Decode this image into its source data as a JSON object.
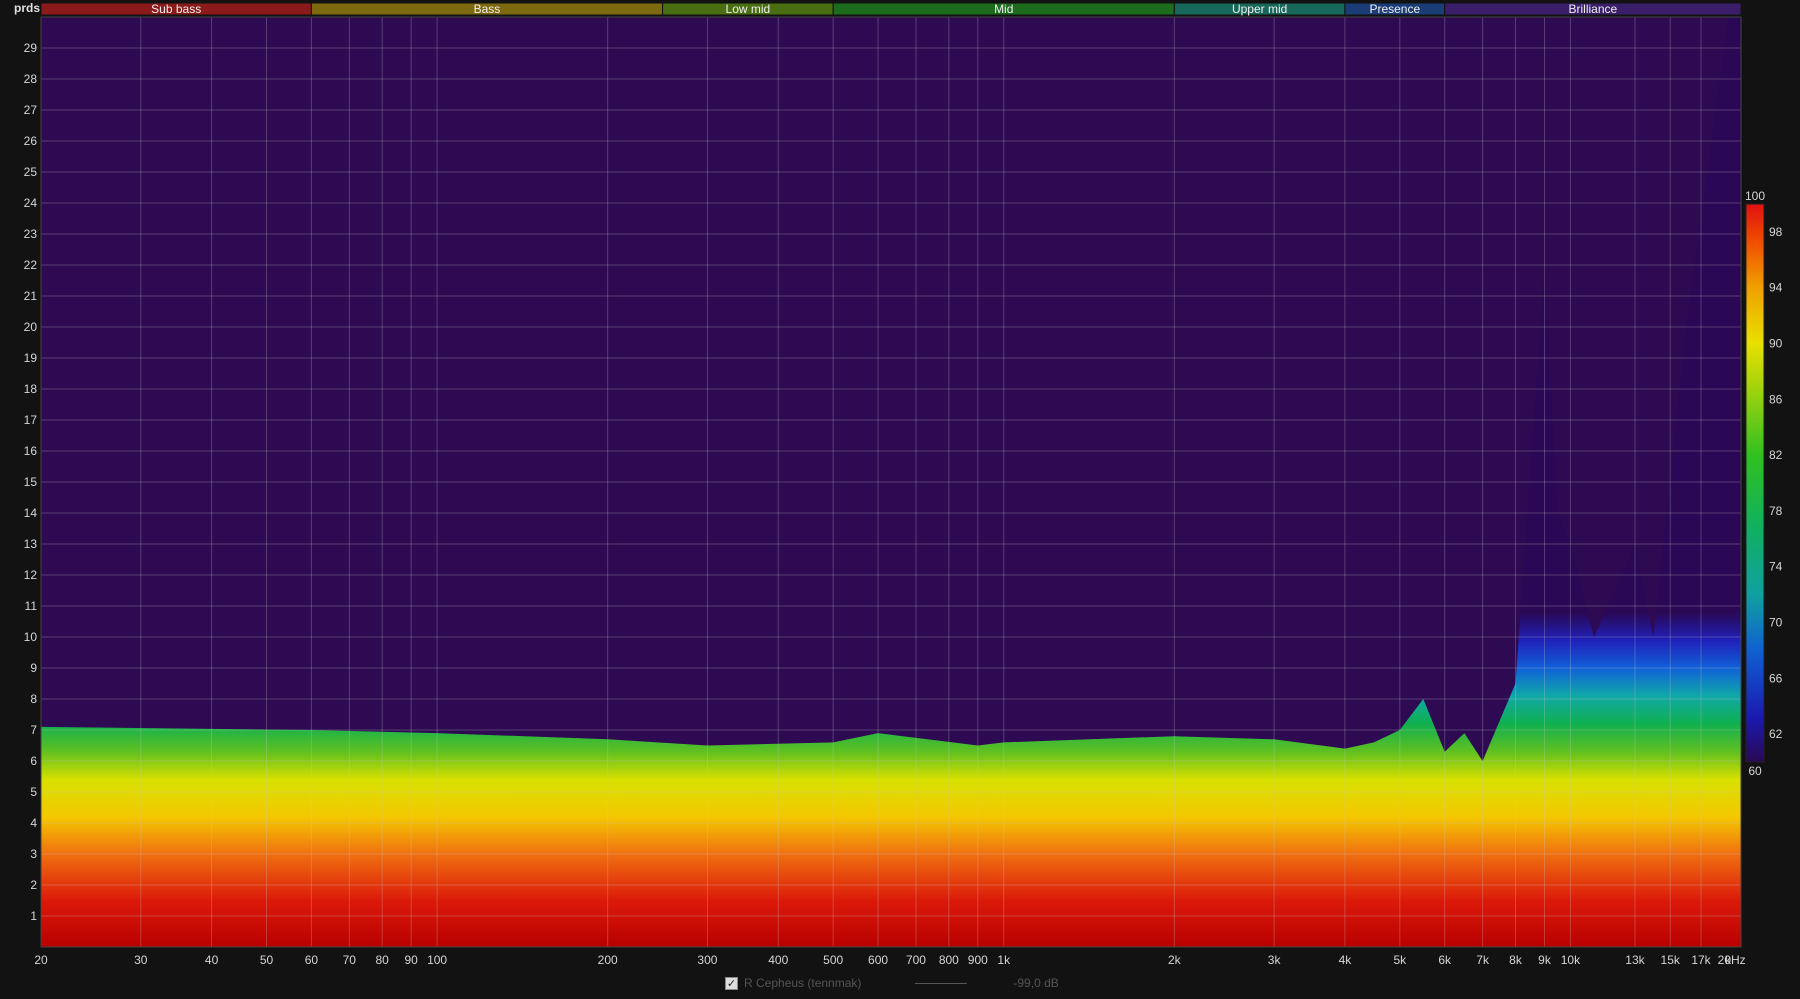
{
  "chart_data": {
    "type": "heatmap",
    "title": "",
    "y_unit_label": "prds",
    "x_unit_label": "kHz",
    "x_scale": "log",
    "x_range_hz": [
      20,
      20000
    ],
    "y_range_periods": [
      0,
      30
    ],
    "y_ticks": [
      "1",
      "2",
      "3",
      "4",
      "5",
      "6",
      "7",
      "8",
      "9",
      "10",
      "11",
      "12",
      "13",
      "14",
      "15",
      "16",
      "17",
      "18",
      "19",
      "20",
      "21",
      "22",
      "23",
      "24",
      "25",
      "26",
      "27",
      "28",
      "29"
    ],
    "x_ticks": [
      {
        "hz": 20,
        "label": "20"
      },
      {
        "hz": 30,
        "label": "30"
      },
      {
        "hz": 40,
        "label": "40"
      },
      {
        "hz": 50,
        "label": "50"
      },
      {
        "hz": 60,
        "label": "60"
      },
      {
        "hz": 70,
        "label": "70"
      },
      {
        "hz": 80,
        "label": "80"
      },
      {
        "hz": 90,
        "label": "90"
      },
      {
        "hz": 100,
        "label": "100"
      },
      {
        "hz": 200,
        "label": "200"
      },
      {
        "hz": 300,
        "label": "300"
      },
      {
        "hz": 400,
        "label": "400"
      },
      {
        "hz": 500,
        "label": "500"
      },
      {
        "hz": 600,
        "label": "600"
      },
      {
        "hz": 700,
        "label": "700"
      },
      {
        "hz": 800,
        "label": "800"
      },
      {
        "hz": 900,
        "label": "900"
      },
      {
        "hz": 1000,
        "label": "1k"
      },
      {
        "hz": 2000,
        "label": "2k"
      },
      {
        "hz": 3000,
        "label": "3k"
      },
      {
        "hz": 4000,
        "label": "4k"
      },
      {
        "hz": 5000,
        "label": "5k"
      },
      {
        "hz": 6000,
        "label": "6k"
      },
      {
        "hz": 7000,
        "label": "7k"
      },
      {
        "hz": 8000,
        "label": "8k"
      },
      {
        "hz": 9000,
        "label": "9k"
      },
      {
        "hz": 10000,
        "label": "10k"
      },
      {
        "hz": 13000,
        "label": "13k"
      },
      {
        "hz": 15000,
        "label": "15k"
      },
      {
        "hz": 17000,
        "label": "17k"
      },
      {
        "hz": 20000,
        "label": "20"
      }
    ],
    "bands": [
      {
        "name": "Sub bass",
        "from_hz": 20,
        "to_hz": 60,
        "color": "#8b1a1a"
      },
      {
        "name": "Bass",
        "from_hz": 60,
        "to_hz": 250,
        "color": "#7d6a10"
      },
      {
        "name": "Low mid",
        "from_hz": 250,
        "to_hz": 500,
        "color": "#4a6e12"
      },
      {
        "name": "Mid",
        "from_hz": 500,
        "to_hz": 2000,
        "color": "#1d6b1d"
      },
      {
        "name": "Upper mid",
        "from_hz": 2000,
        "to_hz": 4000,
        "color": "#17685a"
      },
      {
        "name": "Presence",
        "from_hz": 4000,
        "to_hz": 6000,
        "color": "#1a3d78"
      },
      {
        "name": "Brilliance",
        "from_hz": 6000,
        "to_hz": 20000,
        "color": "#3a1e6a"
      }
    ],
    "colorbar": {
      "min": 60,
      "max": 100,
      "ticks": [
        "60",
        "62",
        "66",
        "70",
        "74",
        "78",
        "82",
        "86",
        "90",
        "94",
        "98",
        "100"
      ],
      "colors": [
        "#2a0855",
        "#1a1ab0",
        "#1060d0",
        "#10a0a0",
        "#10b060",
        "#20c020",
        "#80d010",
        "#e8e000",
        "#f0a000",
        "#f05000",
        "#e01010"
      ]
    },
    "baseline_contour_periods": [
      {
        "hz": 20,
        "top": 7.1
      },
      {
        "hz": 60,
        "top": 7.0
      },
      {
        "hz": 100,
        "top": 6.9
      },
      {
        "hz": 200,
        "top": 6.7
      },
      {
        "hz": 300,
        "top": 6.5
      },
      {
        "hz": 500,
        "top": 6.6
      },
      {
        "hz": 600,
        "top": 6.9
      },
      {
        "hz": 900,
        "top": 6.5
      },
      {
        "hz": 1000,
        "top": 6.6
      },
      {
        "hz": 2000,
        "top": 6.8
      },
      {
        "hz": 3000,
        "top": 6.7
      },
      {
        "hz": 4000,
        "top": 6.4
      },
      {
        "hz": 4500,
        "top": 6.6
      },
      {
        "hz": 5000,
        "top": 7.0
      },
      {
        "hz": 5500,
        "top": 8.0
      },
      {
        "hz": 6000,
        "top": 6.3
      },
      {
        "hz": 6500,
        "top": 6.9
      },
      {
        "hz": 7000,
        "top": 6.0
      },
      {
        "hz": 8000,
        "top": 8.5
      },
      {
        "hz": 9000,
        "top": 22.0
      },
      {
        "hz": 9500,
        "top": 14.0
      },
      {
        "hz": 10000,
        "top": 13.0
      },
      {
        "hz": 11000,
        "top": 10.0
      },
      {
        "hz": 13000,
        "top": 13.0
      },
      {
        "hz": 14000,
        "top": 10.0
      },
      {
        "hz": 16000,
        "top": 20.0
      },
      {
        "hz": 19000,
        "top": 30.0
      },
      {
        "hz": 20000,
        "top": 30.0
      }
    ]
  },
  "legend": {
    "checked": true,
    "series_label": "R Cepheus (tennmak)",
    "value_label": "-99,0 dB"
  }
}
